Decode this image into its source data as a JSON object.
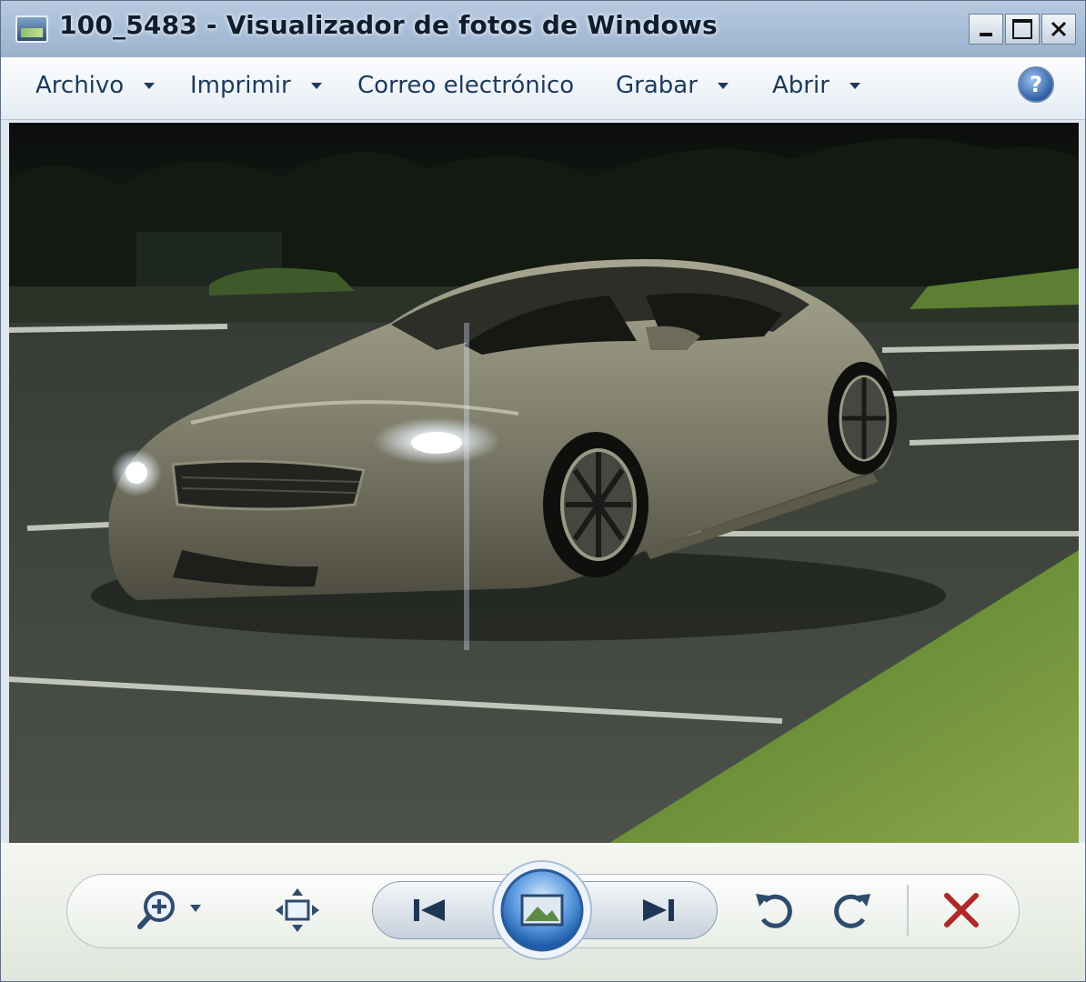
{
  "window": {
    "title": "100_5483 - Visualizador de fotos de Windows",
    "controls": [
      "minimize",
      "maximize",
      "close"
    ]
  },
  "menu": {
    "items": [
      {
        "label": "Archivo",
        "has_dropdown": true
      },
      {
        "label": "Imprimir",
        "has_dropdown": true
      },
      {
        "label": "Correo electrónico",
        "has_dropdown": false
      },
      {
        "label": "Grabar",
        "has_dropdown": true
      },
      {
        "label": "Abrir",
        "has_dropdown": true
      }
    ],
    "help_icon": "help-icon"
  },
  "photo": {
    "subject": "silver coupe in parking lot at night",
    "colors": {
      "asphalt": "#3b3f38",
      "grass": "#6f8f3a",
      "car": "#8f8d78"
    }
  },
  "toolbar": {
    "icons": [
      "zoom-icon",
      "fit-to-window-icon",
      "previous-icon",
      "slideshow-icon",
      "next-icon",
      "rotate-counterclockwise-icon",
      "rotate-clockwise-icon",
      "delete-icon"
    ],
    "accent": "#3a7fd1",
    "delete_color": "#b02828"
  }
}
